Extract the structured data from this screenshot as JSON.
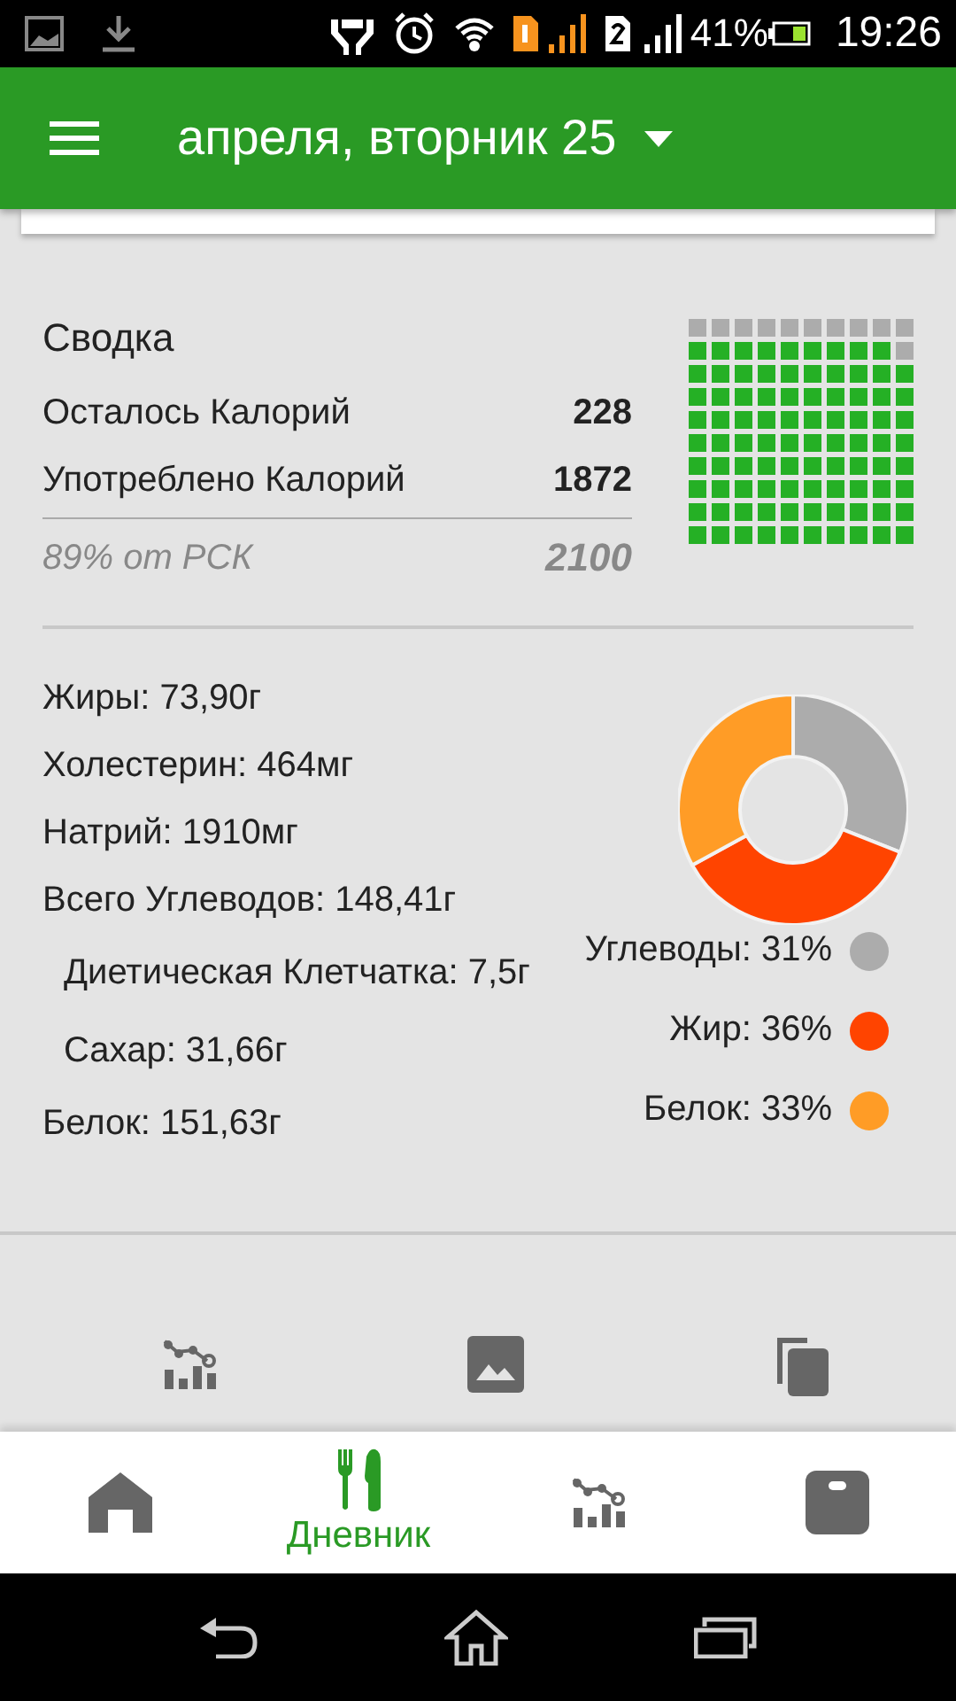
{
  "status_bar": {
    "battery": "41%",
    "time": "19:26"
  },
  "app_bar": {
    "title": "апреля, вторник 25"
  },
  "summary": {
    "title": "Сводка",
    "rows": [
      {
        "label": "Осталось Калорий",
        "value": "228"
      },
      {
        "label": "Употреблено Калорий",
        "value": "1872"
      }
    ],
    "goal_label": "89% от РСК",
    "goal_value": "2100"
  },
  "nutrients": [
    {
      "text": "Жиры: 73,90г"
    },
    {
      "text": "Холестерин: 464мг"
    },
    {
      "text": "Натрий: 1910мг"
    },
    {
      "text": "Всего Углеводов: 148,41г",
      "children": [
        {
          "text": "Диетическая Клетчатка: 7,5г"
        },
        {
          "text": "Сахар: 31,66г"
        }
      ]
    },
    {
      "text": "Белок: 151,63г"
    }
  ],
  "macros": {
    "chart_data": {
      "type": "donut",
      "values": [
        31,
        36,
        33
      ]
    },
    "legend": [
      {
        "text": "Углеводы: 31%",
        "color": "#acacac"
      },
      {
        "text": "Жир: 36%",
        "color": "#ff4400"
      },
      {
        "text": "Белок: 33%",
        "color": "#ff9c26"
      }
    ]
  },
  "actions": [
    {
      "kind": "chart"
    },
    {
      "kind": "image"
    },
    {
      "kind": "copy"
    }
  ],
  "bottom_nav": [
    {
      "kind": "home",
      "selected": false
    },
    {
      "kind": "diary",
      "label": "Дневник",
      "selected": true
    },
    {
      "kind": "chart",
      "selected": false
    },
    {
      "kind": "scale",
      "selected": false
    }
  ]
}
